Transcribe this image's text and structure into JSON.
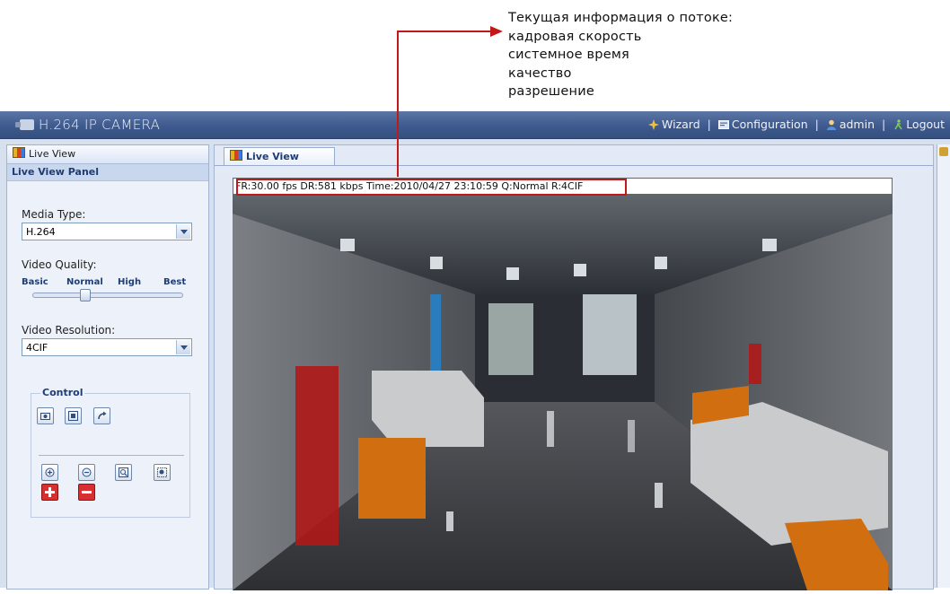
{
  "annotation": {
    "lines": [
      "Текущая информация о потоке:",
      "кадровая скорость",
      "системное время",
      "качество",
      "разрешение"
    ],
    "color": "#c21818"
  },
  "header": {
    "title": "H.264 IP CAMERA",
    "nav": {
      "wizard": "Wizard",
      "configuration": "Configuration",
      "admin": "admin",
      "logout": "Logout",
      "separator": "|"
    }
  },
  "left_panel": {
    "tab": "Live View",
    "title": "Live View Panel",
    "media_type": {
      "label": "Media Type:",
      "value": "H.264"
    },
    "video_quality": {
      "label": "Video Quality:",
      "levels": [
        "Basic",
        "Normal",
        "High",
        "Best"
      ],
      "selected": "Normal"
    },
    "video_resolution": {
      "label": "Video Resolution:",
      "value": "4CIF"
    },
    "control": {
      "legend": "Control",
      "buttons": [
        "snapshot-icon",
        "fullscreen-icon",
        "refresh-icon",
        "zoom-in-icon",
        "zoom-out-icon",
        "zoom-fit-icon",
        "zoom-region-icon",
        "plus-icon",
        "minus-icon"
      ]
    }
  },
  "center_panel": {
    "tab": "Live View",
    "stream_info": "FR:30.00 fps  DR:581 kbps Time:2010/04/27 23:10:59 Q:Normal R:4CIF"
  },
  "colors": {
    "header_bar": "#3e5a8e",
    "panel_bg": "#edf2fa",
    "accent_text": "#1f3d73",
    "highlight": "#c21818"
  }
}
